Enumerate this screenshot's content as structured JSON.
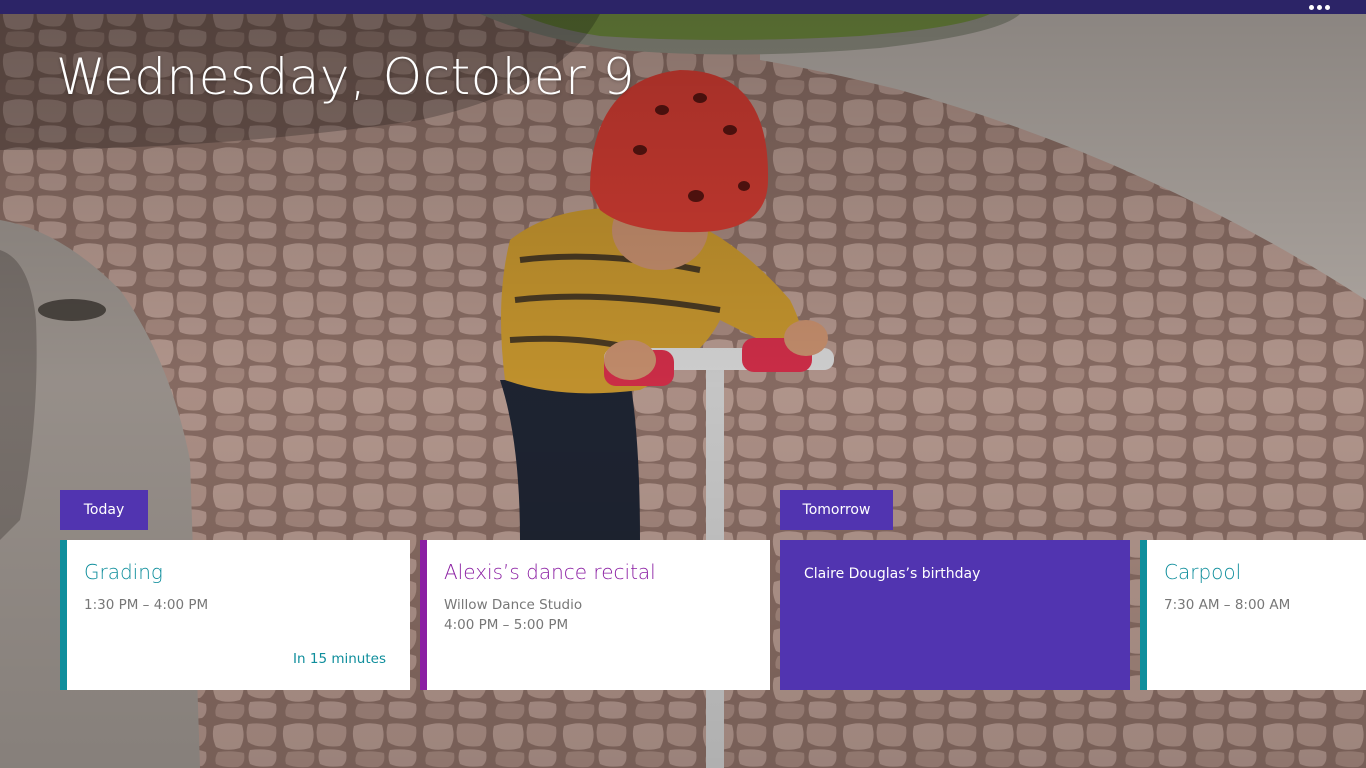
{
  "app": {
    "date_title": "Wednesday, October 9",
    "more_icon": "ellipsis-icon"
  },
  "colors": {
    "top_bar": "#2c2467",
    "label_bg": "#5134b0",
    "teal_accent": "#0f8e9c",
    "magenta_accent": "#8b1fa3",
    "birthday_bg": "#5134b0"
  },
  "groups": [
    {
      "label": "Today"
    },
    {
      "label": "Tomorrow"
    }
  ],
  "events": [
    {
      "title": "Grading",
      "time": "1:30 PM – 4:00 PM",
      "countdown": "In 15 minutes"
    },
    {
      "title": "Alexis’s dance recital",
      "location": "Willow Dance Studio",
      "time": "4:00 PM – 5:00 PM"
    },
    {
      "title": "Claire Douglas’s birthday"
    },
    {
      "title": "Carpool",
      "time": "7:30 AM – 8:00 AM"
    }
  ]
}
